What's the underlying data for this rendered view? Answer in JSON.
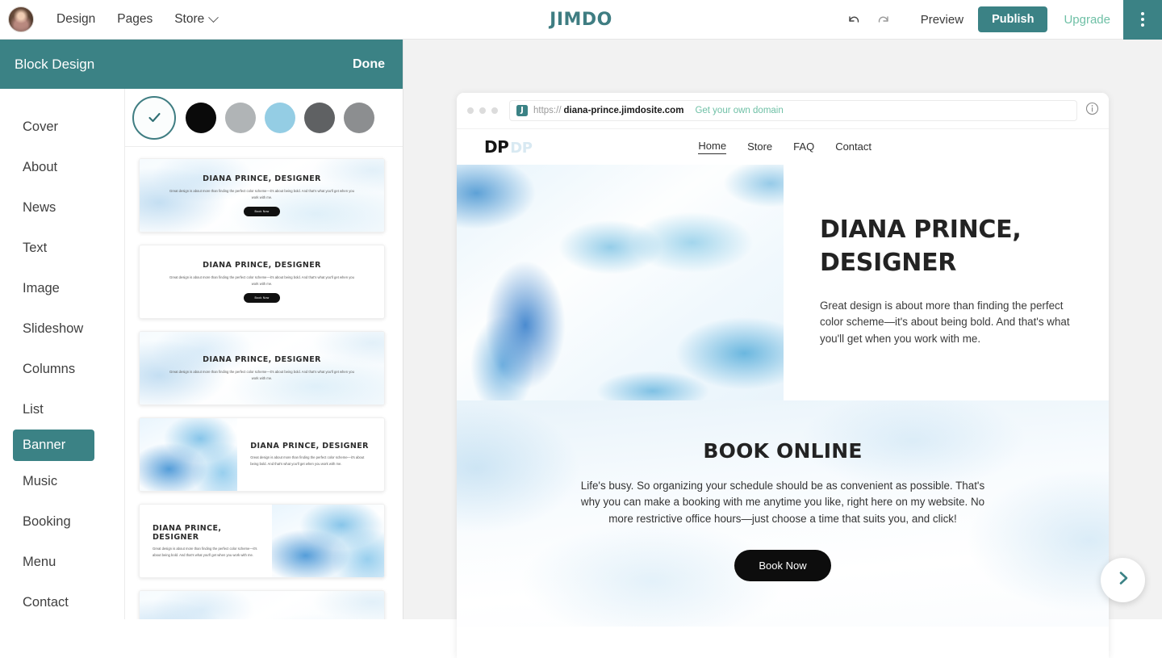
{
  "topbar": {
    "avatar_name": "user-avatar",
    "nav": [
      {
        "label": "Design",
        "has_caret": false
      },
      {
        "label": "Pages",
        "has_caret": false
      },
      {
        "label": "Store",
        "has_caret": true
      }
    ],
    "brand": "JIMDO",
    "undo_icon": "undo-icon",
    "redo_icon": "redo-icon",
    "preview_label": "Preview",
    "publish_label": "Publish",
    "upgrade_label": "Upgrade",
    "menu_icon": "kebab-menu-icon"
  },
  "panel": {
    "title": "Block Design",
    "done_label": "Done",
    "categories": [
      "Cover",
      "About",
      "News",
      "Text",
      "Image",
      "Slideshow",
      "Columns",
      "List",
      "Banner",
      "Music",
      "Booking",
      "Menu",
      "Contact"
    ],
    "active_category": "Banner",
    "swatches": [
      {
        "name": "selected-check",
        "color": "#ffffff",
        "selected": true
      },
      {
        "name": "black",
        "color": "#0a0a0a",
        "selected": false
      },
      {
        "name": "light-gray",
        "color": "#b0b4b6",
        "selected": false
      },
      {
        "name": "light-blue",
        "color": "#94cde4",
        "selected": false
      },
      {
        "name": "dark-gray",
        "color": "#5f6163",
        "selected": false
      },
      {
        "name": "mid-gray",
        "color": "#8c8e90",
        "selected": false
      }
    ],
    "accent_color": "#3b8285",
    "templates": [
      {
        "layout": "center",
        "wash": "soft",
        "heading": "DIANA PRINCE, DESIGNER",
        "body": "Great design is about more than finding the perfect color scheme—it's about being bold. And that's what you'll get when you work with me.",
        "button": "Book Now"
      },
      {
        "layout": "center",
        "wash": "none",
        "heading": "DIANA PRINCE, DESIGNER",
        "body": "Great design is about more than finding the perfect color scheme—it's about being bold. And that's what you'll get when you work with me.",
        "button": "Book Now"
      },
      {
        "layout": "center",
        "wash": "soft",
        "heading": "DIANA PRINCE, DESIGNER",
        "body": "Great design is about more than finding the perfect color scheme—it's about being bold. And that's what you'll get when you work with me.",
        "button": ""
      },
      {
        "layout": "image-left",
        "wash": "none",
        "heading": "DIANA PRINCE, DESIGNER",
        "body": "Great design is about more than finding the perfect color scheme—it's about being bold. And that's what you'll get when you work with me.",
        "button": ""
      },
      {
        "layout": "image-right",
        "wash": "none",
        "heading": "DIANA PRINCE, DESIGNER",
        "body": "Great design is about more than finding the perfect color scheme—it's about being bold. And that's what you'll get when you work with me.",
        "button": ""
      }
    ]
  },
  "preview": {
    "browser": {
      "protocol": "https://",
      "host": "diana-prince.jimdosite.com",
      "cta": "Get your own domain",
      "badge": "J",
      "info_icon": "info-icon"
    },
    "site": {
      "logo": "DP",
      "logo_ghost": "DP",
      "nav": [
        {
          "label": "Home",
          "active": true
        },
        {
          "label": "Store",
          "active": false
        },
        {
          "label": "FAQ",
          "active": false
        },
        {
          "label": "Contact",
          "active": false
        }
      ],
      "hero": {
        "heading": "DIANA PRINCE, DESIGNER",
        "body": "Great design is about more than finding the perfect color scheme—it's about being bold. And that's what you'll get when you work with me."
      },
      "booking": {
        "heading": "BOOK ONLINE",
        "body": "Life's busy. So organizing your schedule should be as convenient as possible. That's why you can make a booking with me anytime you like, right here on my website. No more restrictive office hours—just choose a time that suits you, and click!",
        "button": "Book Now"
      }
    },
    "next_icon": "chevron-right-icon"
  }
}
